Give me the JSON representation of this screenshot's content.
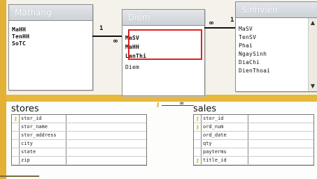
{
  "top": {
    "table_mathang": {
      "title": "Mathang",
      "fields": [
        "MaHH",
        "TenHH",
        "SoTC"
      ]
    },
    "table_diem": {
      "title": "Diem",
      "fields": [
        "MaSV",
        "MaHH",
        "LanThi"
      ],
      "extra": "Diem"
    },
    "table_sinhvien": {
      "title": "Sinhvien",
      "fields": [
        "MaSV",
        "TenSV",
        "Phai",
        "NgaySinh",
        "DiaChi",
        "DienThoai"
      ]
    },
    "rel_left": {
      "one": "1",
      "many": "∞"
    },
    "rel_right": {
      "one": "1",
      "many": "∞"
    }
  },
  "bottom": {
    "table_stores": {
      "title": "stores",
      "fields": [
        "stor_id",
        "stor_name",
        "stor_address",
        "city",
        "state",
        "zip"
      ]
    },
    "table_sales": {
      "title": "sales",
      "fields": [
        "stor_id",
        "ord_num",
        "ord_date",
        "qty",
        "payterms",
        "title_id"
      ]
    }
  },
  "colors": {
    "background": "#e8b83a",
    "highlight": "#e02020",
    "key": "#c9a400"
  },
  "icons": {
    "primary_key": "key-icon"
  }
}
